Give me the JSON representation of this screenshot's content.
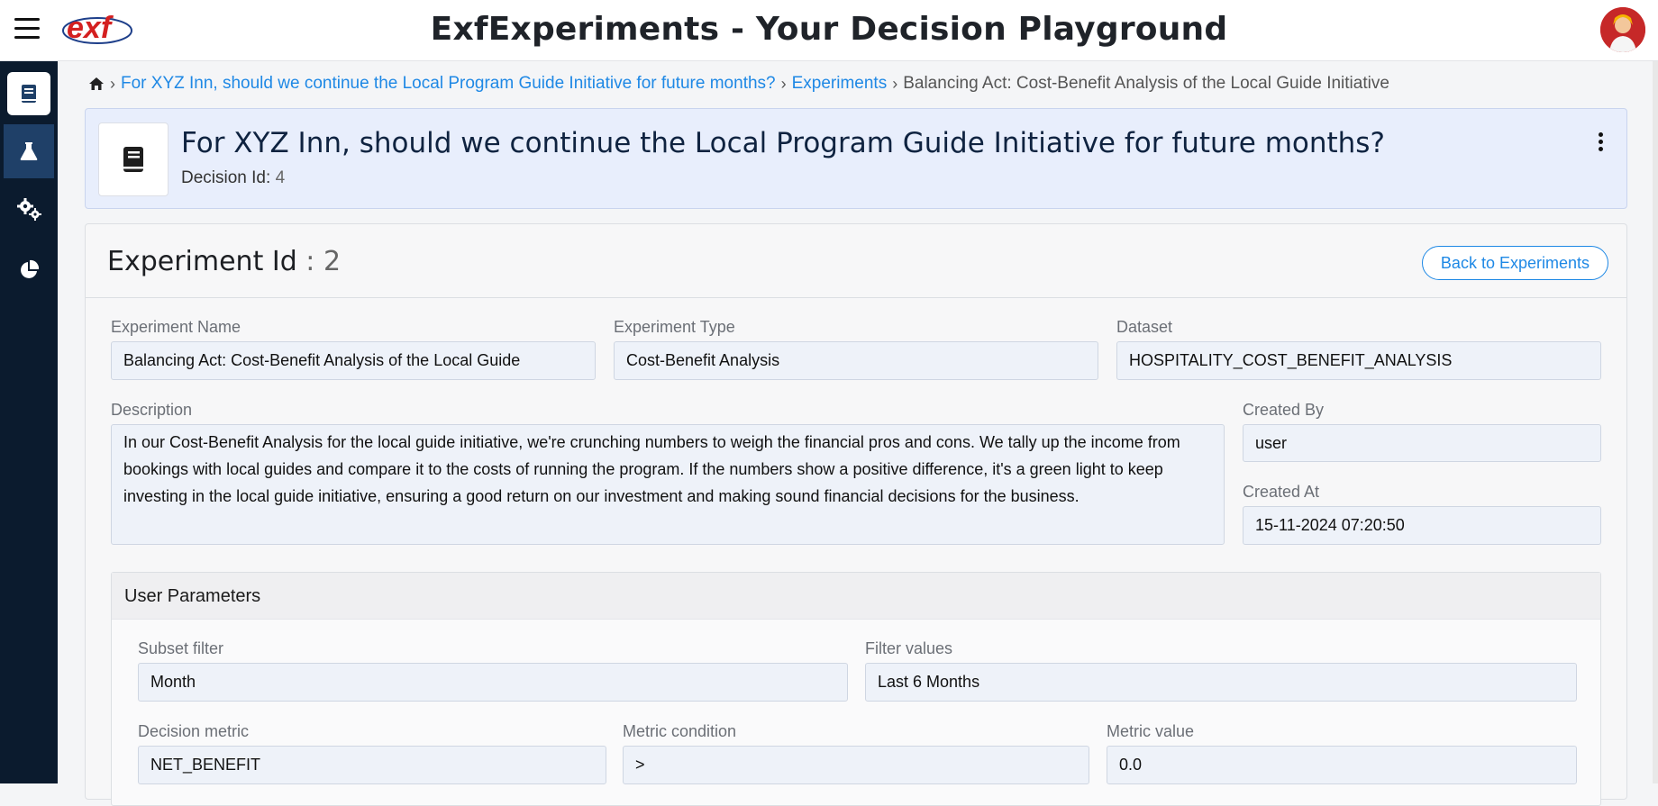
{
  "app": {
    "title": "ExfExperiments - Your Decision Playground",
    "logo_text": "exf"
  },
  "sidebar": {
    "items": [
      {
        "icon": "book-icon"
      },
      {
        "icon": "flask-icon"
      },
      {
        "icon": "gears-icon"
      },
      {
        "icon": "pie-chart-icon"
      }
    ]
  },
  "breadcrumb": {
    "home_icon": "home-icon",
    "decision_link": "For XYZ Inn, should we continue the Local Program Guide Initiative for future months?",
    "experiments_link": "Experiments",
    "current": "Balancing Act: Cost-Benefit Analysis of the Local Guide Initiative"
  },
  "decision": {
    "title": "For XYZ Inn, should we continue the Local Program Guide Initiative for future months?",
    "id_label": "Decision Id:",
    "id_value": "4"
  },
  "experiment": {
    "title_label": "Experiment Id",
    "title_value": " : 2",
    "back_button": "Back to Experiments",
    "fields": {
      "name_label": "Experiment Name",
      "name_value": "Balancing Act: Cost-Benefit Analysis of the Local Guide",
      "type_label": "Experiment Type",
      "type_value": "Cost-Benefit Analysis",
      "dataset_label": "Dataset",
      "dataset_value": "HOSPITALITY_COST_BENEFIT_ANALYSIS",
      "description_label": "Description",
      "description_value": "In our Cost-Benefit Analysis for the local guide initiative, we're crunching numbers to weigh the financial pros and cons. We tally up the income from bookings with local guides and compare it to the costs of running the program. If the numbers show a positive difference, it's a green light to keep investing in the local guide initiative, ensuring a good return on our investment and making sound financial decisions for the business.",
      "created_by_label": "Created By",
      "created_by_value": "user",
      "created_at_label": "Created At",
      "created_at_value": "15-11-2024 07:20:50"
    },
    "user_parameters": {
      "title": "User Parameters",
      "subset_filter_label": "Subset filter",
      "subset_filter_value": "Month",
      "filter_values_label": "Filter values",
      "filter_values_value": "Last 6 Months",
      "decision_metric_label": "Decision metric",
      "decision_metric_value": "NET_BENEFIT",
      "metric_condition_label": "Metric condition",
      "metric_condition_value": ">",
      "metric_value_label": "Metric value",
      "metric_value_value": "0.0"
    }
  },
  "colors": {
    "sidebar_bg": "#0b1b2e",
    "link": "#1e88e5",
    "decision_card_bg": "#e8eefc",
    "field_bg": "#eef2f9"
  }
}
